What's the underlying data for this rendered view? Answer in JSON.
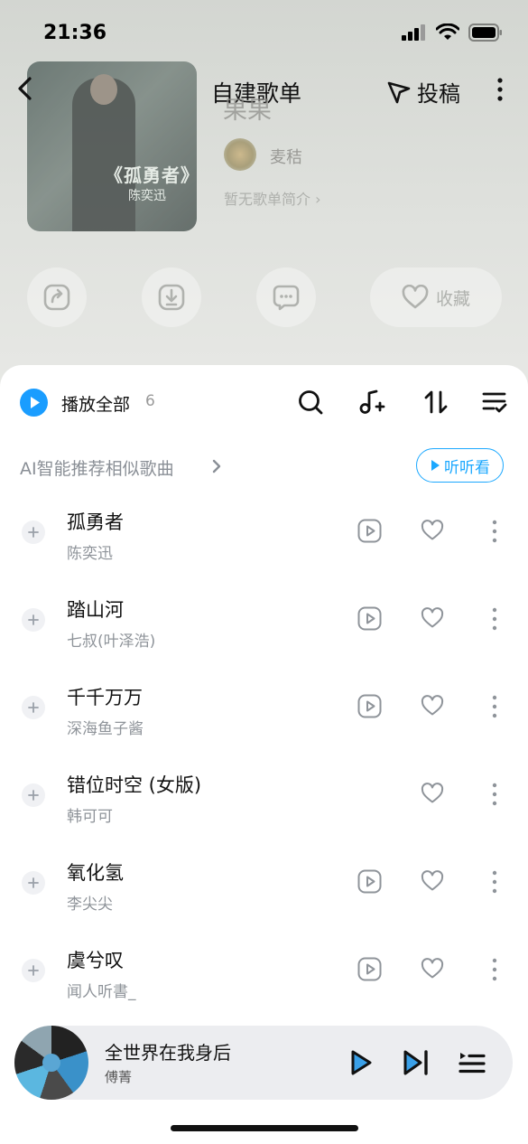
{
  "status_bar": {
    "time": "21:36"
  },
  "header": {
    "title": "自建歌单",
    "contribute_label": "投稿"
  },
  "playlist": {
    "name": "果果",
    "creator": "麦秸",
    "description": "暂无歌单简介",
    "cover_title": "《孤勇者》",
    "cover_subtitle": "陈奕迅"
  },
  "actions": {
    "favorite_label": "收藏"
  },
  "toolbar": {
    "play_all_label": "播放全部",
    "song_count": "6"
  },
  "ai_recommend": {
    "label": "AI智能推荐相似歌曲",
    "button_label": "听听看"
  },
  "songs": [
    {
      "title": "孤勇者",
      "artist": "陈奕迅"
    },
    {
      "title": "踏山河",
      "artist": "七叔(叶泽浩)"
    },
    {
      "title": "千千万万",
      "artist": "深海鱼子酱"
    },
    {
      "title": "错位时空 (女版)",
      "artist": "韩可可"
    },
    {
      "title": "氧化氢",
      "artist": "李尖尖"
    },
    {
      "title": "虞兮叹",
      "artist": "闻人听書_"
    }
  ],
  "mini_player": {
    "title": "全世界在我身后",
    "artist": "傅菁"
  },
  "colors": {
    "accent": "#1a9dff",
    "secondary_text": "#8f949a"
  }
}
